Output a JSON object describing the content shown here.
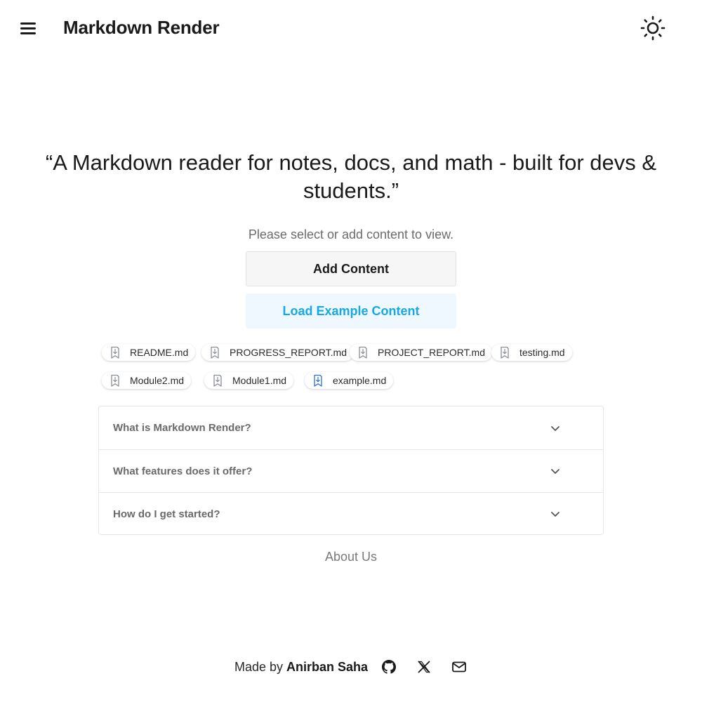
{
  "header": {
    "title": "Markdown Render",
    "menu_icon": "hamburger-menu-icon",
    "theme_icon": "sun-icon"
  },
  "hero": {
    "tagline": "“A Markdown reader for notes, docs, and math - built for devs & students.”",
    "subtitle": "Please select or add content to view."
  },
  "actions": {
    "add_label": "Add Content",
    "load_label": "Load Example Content"
  },
  "files": [
    {
      "name": "README.md",
      "active": false
    },
    {
      "name": "PROGRESS_REPORT.md",
      "active": false
    },
    {
      "name": "PROJECT_REPORT.md",
      "active": false
    },
    {
      "name": "testing.md",
      "active": false
    },
    {
      "name": "Module2.md",
      "active": false
    },
    {
      "name": "Module1.md",
      "active": false
    },
    {
      "name": "example.md",
      "active": true
    }
  ],
  "faq": [
    {
      "question": "What is Markdown Render?"
    },
    {
      "question": "What features does it offer?"
    },
    {
      "question": "How do I get started?"
    }
  ],
  "about_label": "About Us",
  "footer": {
    "made_by": "Made by",
    "author": "Anirban Saha",
    "icons": [
      "github-icon",
      "x-icon",
      "mail-icon"
    ]
  },
  "colors": {
    "accent": "#17a9e5",
    "accent_bg": "#eff8fe",
    "file_icon": "#8a8f94",
    "file_icon_active": "#2f6fd1"
  }
}
